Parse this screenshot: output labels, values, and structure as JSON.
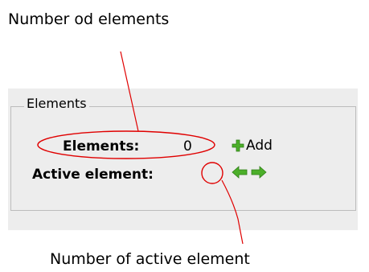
{
  "annotations": {
    "top": "Number od elements",
    "bottom": "Number of active element"
  },
  "group": {
    "title": "Elements"
  },
  "form": {
    "elements_label": "Elements:",
    "elements_value": "0",
    "add_label": "Add",
    "active_label": "Active element:",
    "active_value": ""
  },
  "icons": {
    "add": "plus-icon",
    "prev": "arrow-left-icon",
    "next": "arrow-right-icon"
  },
  "colors": {
    "annotation_line": "#e00000",
    "icon_green": "#4caf2a",
    "panel_bg": "#ededed"
  }
}
